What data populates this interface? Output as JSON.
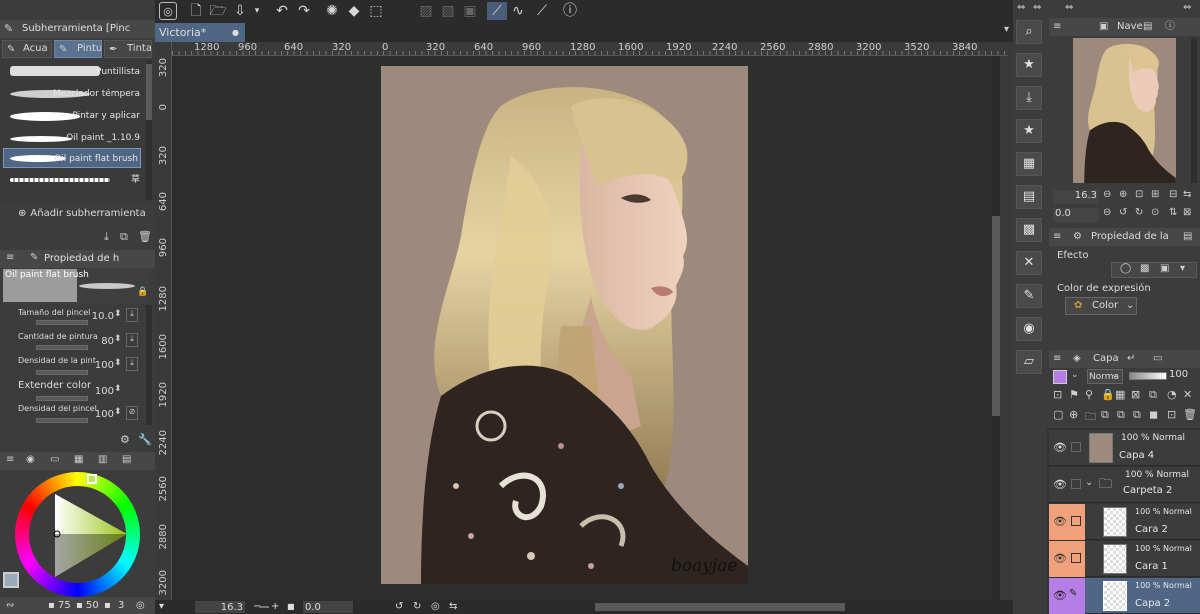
{
  "toolbar": {
    "buttons": [
      "clip-studio-icon",
      "new-file-icon",
      "open-icon",
      "save-icon",
      "share-icon",
      "undo-icon",
      "redo-icon",
      "loading-icon",
      "fill-icon",
      "transform-icon",
      "select-all-icon",
      "deselect-icon",
      "border-icon",
      "pen-curve-icon",
      "smooth-icon",
      "eyedropper-icon",
      "help-icon"
    ]
  },
  "subtool": {
    "title": "Subherramienta [Pinc",
    "tabs": [
      "Acua",
      "Pintu",
      "Tinta"
    ],
    "brushes": [
      "Puntillista",
      "Mezclador témpera",
      "Pintar y aplicar",
      "Oil paint _1.10.9",
      "Oil paint flat brush",
      "草"
    ],
    "selected_index": 4,
    "add_label": "Añadir subherramienta"
  },
  "tool_property": {
    "title": "Propiedad de h",
    "brush_name": "Oil paint flat brush",
    "props": [
      {
        "label": "Tamaño del pincel",
        "value": "10.0"
      },
      {
        "label": "Cantidad de pintura",
        "value": "80"
      },
      {
        "label": "Densidad de la pint",
        "value": "100"
      },
      {
        "label": "Extender color",
        "value": "100"
      },
      {
        "label": "Densidad del pincel",
        "value": "100"
      }
    ]
  },
  "color_panel": {
    "values": [
      "75",
      "50",
      "3"
    ]
  },
  "canvas": {
    "tab_title": "Victoria*",
    "h_ruler": [
      "1280",
      "960",
      "640",
      "320",
      "0",
      "320",
      "640",
      "960",
      "1280",
      "1600",
      "1920",
      "2240",
      "2560",
      "2880",
      "3200",
      "3520",
      "3840"
    ],
    "v_ruler": [
      "320",
      "0",
      "320",
      "640",
      "960",
      "1280",
      "1600",
      "1920",
      "2240",
      "2560",
      "2880",
      "3200"
    ],
    "signature": "boayjae",
    "zoom": "16.3",
    "angle": "0.0"
  },
  "navigator": {
    "title": "Nave",
    "zoom": "16.3",
    "angle": "0.0"
  },
  "layer_property": {
    "title": "Propiedad de la",
    "effect_label": "Efecto",
    "expression_label": "Color de expresión",
    "expression_value": "Color"
  },
  "layers": {
    "title": "Capa",
    "blend_mode": "Norma",
    "opacity": "100",
    "items": [
      {
        "mode": "100 % Normal",
        "name": "Capa 4"
      },
      {
        "mode": "100 % Normal",
        "name": "Carpeta 2"
      },
      {
        "mode": "100 % Normal",
        "name": "Cara 2"
      },
      {
        "mode": "100 % Normal",
        "name": "Cara 1"
      },
      {
        "mode": "100 % Normal",
        "name": "Capa 2"
      }
    ]
  },
  "colors": {
    "canvas_bg": "#9e8a7c",
    "layer_orange": "#f0a07a",
    "layer_purple": "#b57ee6",
    "selected_blue": "#4f6685"
  }
}
